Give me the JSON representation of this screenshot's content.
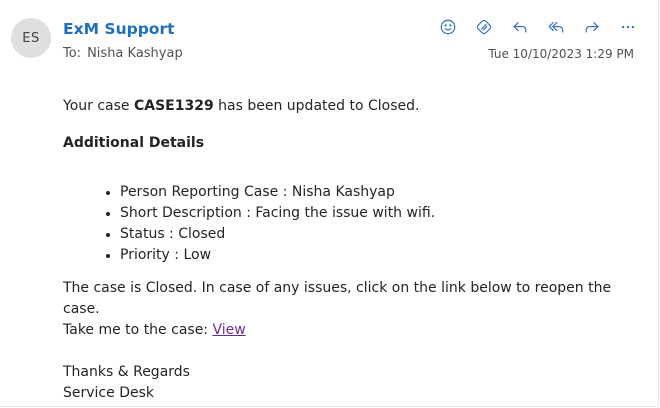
{
  "header": {
    "avatar_initials": "ES",
    "sender": "ExM Support",
    "to_label": "To:",
    "to_name": "Nisha Kashyap",
    "date": "Tue 10/10/2023 1:29 PM",
    "toolbar_icons": [
      "smiley-icon",
      "loop-icon",
      "reply-icon",
      "reply-all-icon",
      "forward-icon",
      "more-icon"
    ]
  },
  "body": {
    "intro_prefix": "Your case ",
    "case_number": "CASE1329",
    "intro_suffix": " has been updated to Closed.",
    "details_heading": "Additional Details",
    "details": [
      "Person Reporting Case : Nisha Kashyap",
      "Short Description : Facing the issue with wifi.",
      "Status : Closed",
      "Priority : Low"
    ],
    "closed_notice": "The case is Closed. In case of any issues, click on the link below to reopen the case.",
    "link_prefix": "Take me to the case: ",
    "link_text": "View",
    "signoff_line1": "Thanks & Regards",
    "signoff_line2": "Service Desk"
  },
  "colors": {
    "accent": "#2d6dc6",
    "sender": "#1f6fbf",
    "link": "#6a2c91",
    "avatar_bg": "#e1dfdd"
  }
}
